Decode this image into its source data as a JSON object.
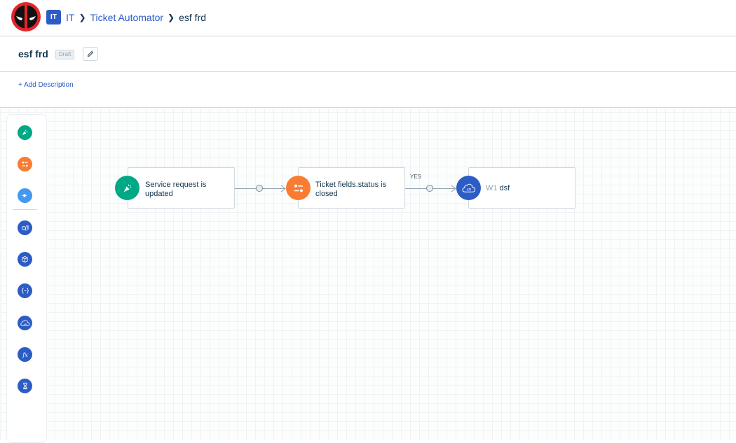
{
  "header": {
    "logo": "deadpool-avatar-icon",
    "breadcrumb": {
      "badge": "IT",
      "items": [
        "IT",
        "Ticket Automator"
      ],
      "current": "esf frd"
    }
  },
  "titlebar": {
    "title": "esf frd",
    "status_badge": "Draft",
    "edit_icon": "pencil-icon"
  },
  "description": {
    "add_label": "+ Add Description"
  },
  "palette": {
    "items": [
      {
        "name": "event-trigger",
        "icon": "cursor-click-icon",
        "color": "#00a886"
      },
      {
        "name": "condition",
        "icon": "sliders-icon",
        "color": "#f97c33"
      },
      {
        "name": "action",
        "icon": "arrow-right-icon",
        "color": "#4598f0"
      },
      {
        "name": "query",
        "icon": "search-list-icon",
        "color": "#2c5cc5"
      },
      {
        "name": "app",
        "icon": "cube-icon",
        "color": "#2c5cc5"
      },
      {
        "name": "json-parser",
        "icon": "braces-icon",
        "color": "#2c5cc5"
      },
      {
        "name": "web-request",
        "icon": "api-cloud-icon",
        "color": "#2c5cc5"
      },
      {
        "name": "expression",
        "icon": "fx-icon",
        "color": "#2c5cc5"
      },
      {
        "name": "timer",
        "icon": "hourglass-icon",
        "color": "#2c5cc5"
      }
    ]
  },
  "flow": {
    "nodes": [
      {
        "text": "Service request is updated",
        "icon": "cursor-click-icon",
        "color": "#00a886"
      },
      {
        "text": "Ticket fields.status is closed",
        "icon": "sliders-icon",
        "color": "#f97c33"
      },
      {
        "prefix": "W1",
        "text": "dsf",
        "icon": "api-cloud-icon",
        "color": "#2c5cc5"
      }
    ],
    "branch_label": "YES"
  }
}
